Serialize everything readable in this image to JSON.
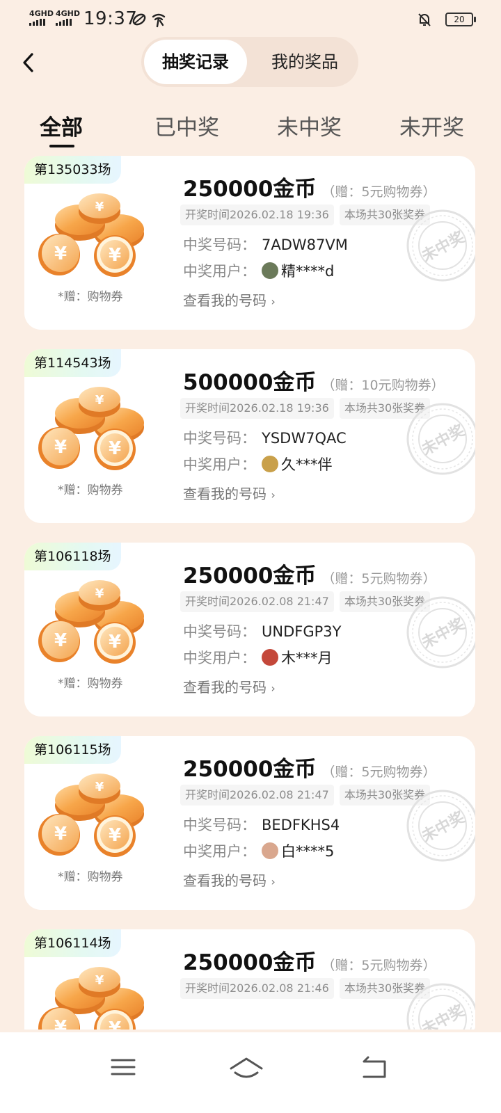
{
  "status_bar": {
    "net1": "4GHD",
    "net2": "4GHD",
    "time": "19:37",
    "battery": "20"
  },
  "header": {
    "segments": [
      "抽奖记录",
      "我的奖品"
    ]
  },
  "tabs": [
    "全部",
    "已中奖",
    "未中奖",
    "未开奖"
  ],
  "labels": {
    "gift_note": "*赠：购物券",
    "win_no": "中奖号码：",
    "win_user": "中奖用户：",
    "view_my": "查看我的号码",
    "stamp": "未中奖"
  },
  "records": [
    {
      "round": "第135033场",
      "prize": "250000金币",
      "gift": "（赠：5元购物券）",
      "draw_time": "开奖时间2026.02.18 19:36",
      "tickets": "本场共30张奖券",
      "code": "7ADW87VM",
      "user": "精****d",
      "avatar_color": "#6b7a5a"
    },
    {
      "round": "第114543场",
      "prize": "500000金币",
      "gift": "（赠：10元购物券）",
      "draw_time": "开奖时间2026.02.18 19:36",
      "tickets": "本场共30张奖券",
      "code": "YSDW7QAC",
      "user": "久***伴",
      "avatar_color": "#c9a04a"
    },
    {
      "round": "第106118场",
      "prize": "250000金币",
      "gift": "（赠：5元购物券）",
      "draw_time": "开奖时间2026.02.08 21:47",
      "tickets": "本场共30张奖券",
      "code": "UNDFGP3Y",
      "user": "木***月",
      "avatar_color": "#c4483a"
    },
    {
      "round": "第106115场",
      "prize": "250000金币",
      "gift": "（赠：5元购物券）",
      "draw_time": "开奖时间2026.02.08 21:47",
      "tickets": "本场共30张奖券",
      "code": "BEDFKHS4",
      "user": "白****5",
      "avatar_color": "#d9a78e"
    },
    {
      "round": "第106114场",
      "prize": "250000金币",
      "gift": "（赠：5元购物券）",
      "draw_time": "开奖时间2026.02.08 21:46",
      "tickets": "本场共30张奖券",
      "code": "",
      "user": "",
      "avatar_color": "#999999"
    }
  ],
  "icons": {
    "back": "chevron-left-icon",
    "mute": "bell-off-icon",
    "nav_menu": "menu-icon",
    "nav_home": "home-icon",
    "nav_back": "back-icon"
  }
}
